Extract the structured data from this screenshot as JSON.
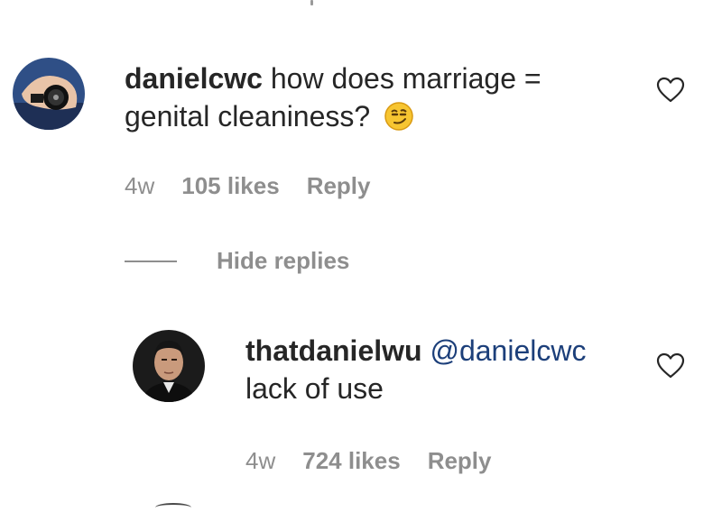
{
  "comment": {
    "username": "danielcwc",
    "text_line1": "how does marriage =",
    "text_line2": "genital cleaniness?",
    "emoji": "smirk-emoji",
    "time": "4w",
    "likes": "105 likes",
    "reply_label": "Reply"
  },
  "thread": {
    "hide_replies_label": "Hide replies"
  },
  "reply": {
    "username": "thatdanielwu",
    "mention": "@danielcwc",
    "text": "lack of use",
    "time": "4w",
    "likes": "724 likes",
    "reply_label": "Reply"
  },
  "icons": {
    "like": "heart-outline-icon"
  },
  "colors": {
    "text": "#262626",
    "muted": "#8e8e8e",
    "mention": "#1c3f7a"
  }
}
